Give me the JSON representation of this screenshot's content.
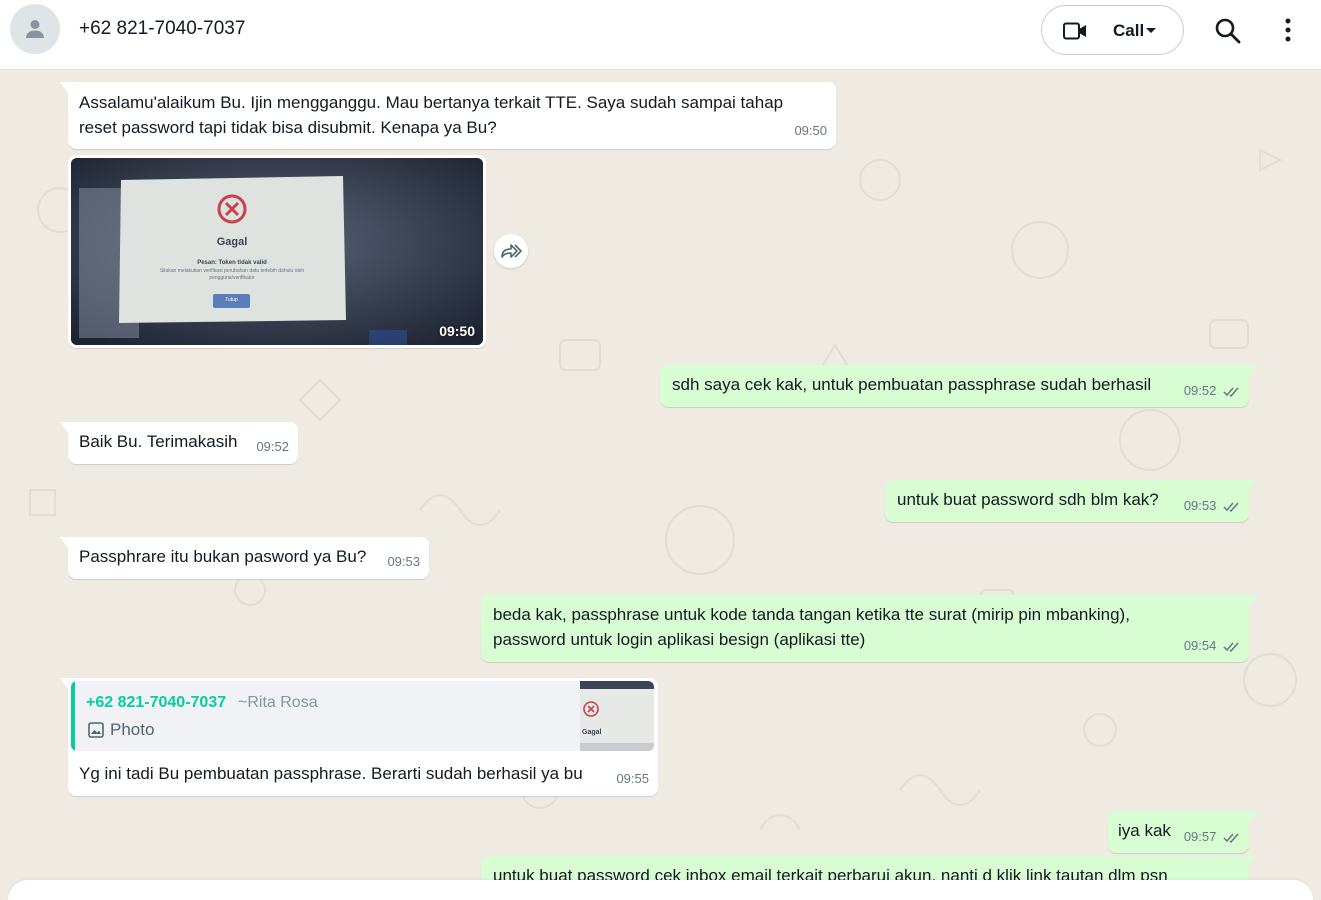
{
  "header": {
    "contact_name": "+62 821-7040-7037",
    "call_label": "Call",
    "icons": {
      "avatar": "person-icon",
      "video": "video-camera-icon",
      "dropdown": "chevron-down-icon",
      "search": "search-icon",
      "menu": "more-vert-icon"
    }
  },
  "messages": [
    {
      "dir": "in",
      "line1": "Assalamu'alaikum Bu. Ijin mengganggu. Mau bertanya terkait TTE. Saya sudah sampai tahap",
      "line2": "reset password tapi tidak bisa disubmit. Kenapa ya Bu?",
      "time": "09:50"
    },
    {
      "dir": "in",
      "type": "image",
      "time": "09:50",
      "image_text": {
        "title": "Gagal",
        "message": "Pesan: Token tidak valid",
        "detail": "Silakan melakukan verifikasi perubahan data terlebih dahulu oleh pengguna/verifikator",
        "button": "Tutup"
      }
    },
    {
      "dir": "out",
      "text": "sdh saya cek kak, untuk pembuatan passphrase sudah berhasil",
      "time": "09:52"
    },
    {
      "dir": "in",
      "text": "Baik Bu. Terimakasih",
      "time": "09:52"
    },
    {
      "dir": "out",
      "text": "untuk buat password sdh blm kak?",
      "time": "09:53"
    },
    {
      "dir": "in",
      "text": "Passphrare itu bukan pasword ya Bu?",
      "time": "09:53"
    },
    {
      "dir": "out",
      "line1": "beda kak, passphrase untuk kode tanda tangan ketika tte surat (mirip pin mbanking),",
      "line2": "password untuk login aplikasi besign (aplikasi tte)",
      "time": "09:54"
    },
    {
      "dir": "in",
      "type": "reply",
      "quote_name": "+62 821-7040-7037",
      "quote_alias": "~Rita Rosa",
      "quote_label": "Photo",
      "quote_thumb_text": "Gagal",
      "text": "Yg ini tadi Bu pembuatan passphrase. Berarti sudah berhasil ya bu",
      "time": "09:55"
    },
    {
      "dir": "out",
      "text": "iya kak",
      "time": "09:57"
    },
    {
      "dir": "out",
      "text": "untuk buat password cek inbox email terkait perbarui akun, nanti d klik link tautan dlm psn"
    }
  ],
  "colors": {
    "incoming": "#ffffff",
    "outgoing": "#d9fdd3",
    "background": "#efeae2",
    "quote_accent": "#06cf9c",
    "read_ticks": "#667781"
  }
}
